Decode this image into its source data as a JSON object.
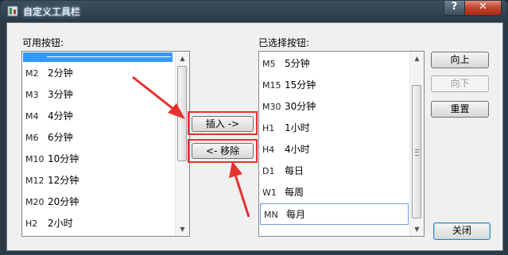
{
  "window": {
    "title": "自定义工具栏",
    "help_glyph": "?",
    "close_glyph": "✕"
  },
  "available": {
    "label": "可用按钮:",
    "items": [
      {
        "code": "",
        "name": "",
        "separator": true
      },
      {
        "code": "M2",
        "name": "2分钟"
      },
      {
        "code": "M3",
        "name": "3分钟"
      },
      {
        "code": "M4",
        "name": "4分钟"
      },
      {
        "code": "M6",
        "name": "6分钟"
      },
      {
        "code": "M10",
        "name": "10分钟"
      },
      {
        "code": "M12",
        "name": "12分钟"
      },
      {
        "code": "M20",
        "name": "20分钟"
      },
      {
        "code": "H2",
        "name": "2小时"
      }
    ]
  },
  "selected": {
    "label": "已选择按钮:",
    "items": [
      {
        "code": "M5",
        "name": "5分钟"
      },
      {
        "code": "M15",
        "name": "15分钟"
      },
      {
        "code": "M30",
        "name": "30分钟"
      },
      {
        "code": "H1",
        "name": "1小时"
      },
      {
        "code": "H4",
        "name": "4小时"
      },
      {
        "code": "D1",
        "name": "每日"
      },
      {
        "code": "W1",
        "name": "每周"
      },
      {
        "code": "MN",
        "name": "每月"
      }
    ]
  },
  "buttons": {
    "insert": "插入 ->",
    "remove": "<- 移除",
    "move_up": "向上",
    "move_down": "向下",
    "reset": "重置",
    "close": "关闭"
  },
  "colors": {
    "highlight_red": "#e8312f",
    "selection_blue": "#3399ff"
  }
}
